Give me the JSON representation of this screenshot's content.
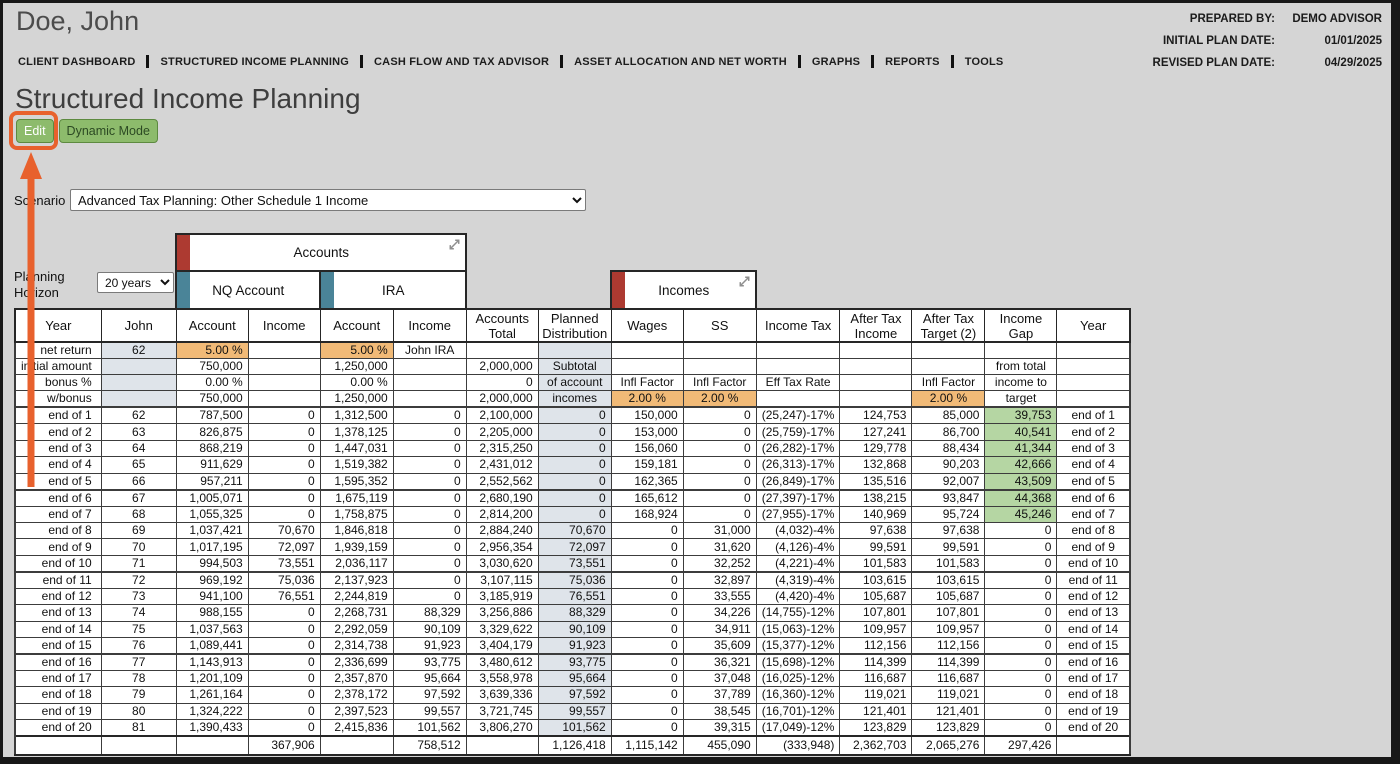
{
  "client": {
    "name": "Doe, John"
  },
  "meta": {
    "rows": [
      {
        "label": "PREPARED BY:",
        "value": "DEMO ADVISOR"
      },
      {
        "label": "INITIAL PLAN DATE:",
        "value": "01/01/2025"
      },
      {
        "label": "REVISED PLAN DATE:",
        "value": "04/29/2025"
      }
    ]
  },
  "nav": {
    "items": [
      "CLIENT DASHBOARD",
      "STRUCTURED INCOME PLANNING",
      "CASH FLOW AND TAX ADVISOR",
      "ASSET ALLOCATION AND NET WORTH",
      "GRAPHS",
      "REPORTS",
      "TOOLS"
    ]
  },
  "page": {
    "title": "Structured Income Planning"
  },
  "toolbar": {
    "edit_label": "Edit",
    "dynamic_mode_label": "Dynamic Mode"
  },
  "scenario": {
    "label": "Scenario",
    "value": "Advanced Tax Planning: Other Schedule 1 Income"
  },
  "planning_horizon": {
    "label": "Planning\nHorizon",
    "value": "20 years"
  },
  "groups": {
    "accounts": "Accounts",
    "nq_account": "NQ Account",
    "ira": "IRA",
    "incomes": "Incomes"
  },
  "icons": {
    "group_expand": "expand-icon"
  },
  "colors": {
    "annotation_orange": "#e8612d",
    "button_green": "#8dbb6c",
    "button_border": "#5d8a40",
    "tab_maroon": "#ad3a31",
    "tab_teal": "#4a8498",
    "cell_orange": "#f1ba77",
    "cell_green": "#b5d6a3",
    "cell_shaded": "#dfe4ea"
  },
  "table": {
    "columns": [
      "Year",
      "John",
      "Account",
      "Income",
      "Account",
      "Income",
      "Accounts\nTotal",
      "Planned\nDistribution",
      "Wages",
      "SS",
      "Income Tax",
      "After Tax\nIncome",
      "After Tax\nTarget (2)",
      "Income\nGap",
      "Year"
    ],
    "setup_rows": [
      [
        "net return",
        "62",
        "5.00 %",
        "",
        "5.00 %",
        "John IRA",
        "",
        "",
        "",
        "",
        "",
        "",
        "",
        "",
        ""
      ],
      [
        "initial amount",
        "",
        "750,000",
        "",
        "1,250,000",
        "",
        "2,000,000",
        "Subtotal",
        "",
        "",
        "",
        "",
        "",
        "from total",
        ""
      ],
      [
        "bonus %",
        "",
        "0.00 %",
        "",
        "0.00 %",
        "",
        "0",
        "of account",
        "Infl Factor",
        "Infl Factor",
        "Eff Tax Rate",
        "",
        "Infl Factor",
        "income to",
        ""
      ],
      [
        "w/bonus",
        "",
        "750,000",
        "",
        "1,250,000",
        "",
        "2,000,000",
        "incomes",
        "2.00 %",
        "2.00 %",
        "",
        "",
        "2.00 %",
        "target",
        ""
      ]
    ],
    "rows": [
      [
        "end of 1",
        "62",
        "787,500",
        "0",
        "1,312,500",
        "0",
        "2,100,000",
        "0",
        "150,000",
        "0",
        "(25,247)-17%",
        "124,753",
        "85,000",
        "39,753",
        "end of 1"
      ],
      [
        "end of 2",
        "63",
        "826,875",
        "0",
        "1,378,125",
        "0",
        "2,205,000",
        "0",
        "153,000",
        "0",
        "(25,759)-17%",
        "127,241",
        "86,700",
        "40,541",
        "end of 2"
      ],
      [
        "end of 3",
        "64",
        "868,219",
        "0",
        "1,447,031",
        "0",
        "2,315,250",
        "0",
        "156,060",
        "0",
        "(26,282)-17%",
        "129,778",
        "88,434",
        "41,344",
        "end of 3"
      ],
      [
        "end of 4",
        "65",
        "911,629",
        "0",
        "1,519,382",
        "0",
        "2,431,012",
        "0",
        "159,181",
        "0",
        "(26,313)-17%",
        "132,868",
        "90,203",
        "42,666",
        "end of 4"
      ],
      [
        "end of 5",
        "66",
        "957,211",
        "0",
        "1,595,352",
        "0",
        "2,552,562",
        "0",
        "162,365",
        "0",
        "(26,849)-17%",
        "135,516",
        "92,007",
        "43,509",
        "end of 5"
      ],
      [
        "end of 6",
        "67",
        "1,005,071",
        "0",
        "1,675,119",
        "0",
        "2,680,190",
        "0",
        "165,612",
        "0",
        "(27,397)-17%",
        "138,215",
        "93,847",
        "44,368",
        "end of 6"
      ],
      [
        "end of 7",
        "68",
        "1,055,325",
        "0",
        "1,758,875",
        "0",
        "2,814,200",
        "0",
        "168,924",
        "0",
        "(27,955)-17%",
        "140,969",
        "95,724",
        "45,246",
        "end of 7"
      ],
      [
        "end of 8",
        "69",
        "1,037,421",
        "70,670",
        "1,846,818",
        "0",
        "2,884,240",
        "70,670",
        "0",
        "31,000",
        "(4,032)-4%",
        "97,638",
        "97,638",
        "0",
        "end of 8"
      ],
      [
        "end of 9",
        "70",
        "1,017,195",
        "72,097",
        "1,939,159",
        "0",
        "2,956,354",
        "72,097",
        "0",
        "31,620",
        "(4,126)-4%",
        "99,591",
        "99,591",
        "0",
        "end of 9"
      ],
      [
        "end of 10",
        "71",
        "994,503",
        "73,551",
        "2,036,117",
        "0",
        "3,030,620",
        "73,551",
        "0",
        "32,252",
        "(4,221)-4%",
        "101,583",
        "101,583",
        "0",
        "end of 10"
      ],
      [
        "end of 11",
        "72",
        "969,192",
        "75,036",
        "2,137,923",
        "0",
        "3,107,115",
        "75,036",
        "0",
        "32,897",
        "(4,319)-4%",
        "103,615",
        "103,615",
        "0",
        "end of 11"
      ],
      [
        "end of 12",
        "73",
        "941,100",
        "76,551",
        "2,244,819",
        "0",
        "3,185,919",
        "76,551",
        "0",
        "33,555",
        "(4,420)-4%",
        "105,687",
        "105,687",
        "0",
        "end of 12"
      ],
      [
        "end of 13",
        "74",
        "988,155",
        "0",
        "2,268,731",
        "88,329",
        "3,256,886",
        "88,329",
        "0",
        "34,226",
        "(14,755)-12%",
        "107,801",
        "107,801",
        "0",
        "end of 13"
      ],
      [
        "end of 14",
        "75",
        "1,037,563",
        "0",
        "2,292,059",
        "90,109",
        "3,329,622",
        "90,109",
        "0",
        "34,911",
        "(15,063)-12%",
        "109,957",
        "109,957",
        "0",
        "end of 14"
      ],
      [
        "end of 15",
        "76",
        "1,089,441",
        "0",
        "2,314,738",
        "91,923",
        "3,404,179",
        "91,923",
        "0",
        "35,609",
        "(15,377)-12%",
        "112,156",
        "112,156",
        "0",
        "end of 15"
      ],
      [
        "end of 16",
        "77",
        "1,143,913",
        "0",
        "2,336,699",
        "93,775",
        "3,480,612",
        "93,775",
        "0",
        "36,321",
        "(15,698)-12%",
        "114,399",
        "114,399",
        "0",
        "end of 16"
      ],
      [
        "end of 17",
        "78",
        "1,201,109",
        "0",
        "2,357,870",
        "95,664",
        "3,558,978",
        "95,664",
        "0",
        "37,048",
        "(16,025)-12%",
        "116,687",
        "116,687",
        "0",
        "end of 17"
      ],
      [
        "end of 18",
        "79",
        "1,261,164",
        "0",
        "2,378,172",
        "97,592",
        "3,639,336",
        "97,592",
        "0",
        "37,789",
        "(16,360)-12%",
        "119,021",
        "119,021",
        "0",
        "end of 18"
      ],
      [
        "end of 19",
        "80",
        "1,324,222",
        "0",
        "2,397,523",
        "99,557",
        "3,721,745",
        "99,557",
        "0",
        "38,545",
        "(16,701)-12%",
        "121,401",
        "121,401",
        "0",
        "end of 19"
      ],
      [
        "end of 20",
        "81",
        "1,390,433",
        "0",
        "2,415,836",
        "101,562",
        "3,806,270",
        "101,562",
        "0",
        "39,315",
        "(17,049)-12%",
        "123,829",
        "123,829",
        "0",
        "end of 20"
      ]
    ],
    "totals": [
      "",
      "",
      "",
      "367,906",
      "",
      "758,512",
      "",
      "1,126,418",
      "1,115,142",
      "455,090",
      "(333,948)",
      "2,362,703",
      "2,065,276",
      "297,426",
      ""
    ]
  }
}
